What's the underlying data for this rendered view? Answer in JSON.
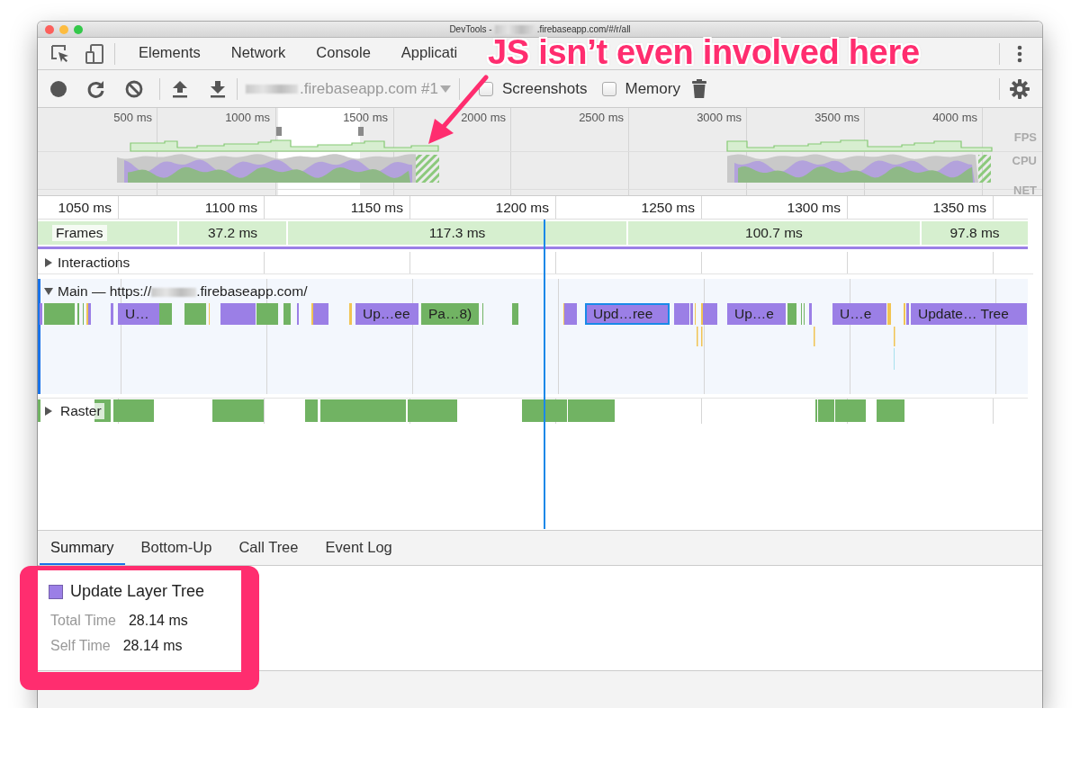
{
  "window": {
    "title_prefix": "DevTools -",
    "title_suffix": ".firebaseapp.com/#/r/all"
  },
  "tabs": [
    {
      "label": "Elements",
      "selected": false
    },
    {
      "label": "Network",
      "selected": false
    },
    {
      "label": "Console",
      "selected": false
    },
    {
      "label": "Applicati",
      "selected": false
    }
  ],
  "toolbar": {
    "recording": {
      "value": ".firebaseapp.com #1",
      "disabled": true
    },
    "checkboxes": [
      {
        "label": "Screenshots",
        "checked": false
      },
      {
        "label": "Memory",
        "checked": false
      }
    ]
  },
  "overview": {
    "ticks": [
      "500 ms",
      "1000 ms",
      "1500 ms",
      "2000 ms",
      "2500 ms",
      "3000 ms",
      "3500 ms",
      "4000 ms"
    ],
    "lanes": [
      "FPS",
      "CPU",
      "NET"
    ]
  },
  "timeline": {
    "ticks": [
      "1050 ms",
      "1100 ms",
      "1150 ms",
      "1200 ms",
      "1250 ms",
      "1300 ms",
      "1350 ms"
    ],
    "frames": {
      "label": "Frames",
      "durations": [
        "37.2 ms",
        "117.3 ms",
        "100.7 ms",
        "97.8 ms"
      ]
    },
    "tracks": [
      {
        "kind": "group",
        "label": "Interactions",
        "expanded": false
      },
      {
        "kind": "main",
        "label_prefix": "Main — https://",
        "label_suffix": ".firebaseapp.com/",
        "expanded": true,
        "events": [
          {
            "label": "U…",
            "kind": "rendering",
            "selected": false
          },
          {
            "label": "Up…ee",
            "kind": "rendering",
            "selected": false
          },
          {
            "label": "Pa…8)",
            "kind": "painting",
            "selected": false
          },
          {
            "label": "Upd…ree",
            "kind": "rendering",
            "selected": true
          },
          {
            "label": "Up…e",
            "kind": "rendering",
            "selected": false
          },
          {
            "label": "U…e",
            "kind": "rendering",
            "selected": false
          },
          {
            "label": "Update… Tree",
            "kind": "rendering",
            "selected": false
          }
        ]
      },
      {
        "kind": "raster",
        "label": "Raster",
        "expanded": false
      }
    ]
  },
  "details": {
    "tabs": [
      {
        "label": "Summary",
        "selected": true
      },
      {
        "label": "Bottom-Up",
        "selected": false
      },
      {
        "label": "Call Tree",
        "selected": false
      },
      {
        "label": "Event Log",
        "selected": false
      }
    ],
    "summary": {
      "title": "Update Layer Tree",
      "color": "#9b7fe6",
      "rows": [
        {
          "label": "Total Time",
          "value": "28.14 ms"
        },
        {
          "label": "Self Time",
          "value": "28.14 ms"
        }
      ]
    }
  },
  "annotation": {
    "headline": "JS isn’t even involved here"
  }
}
